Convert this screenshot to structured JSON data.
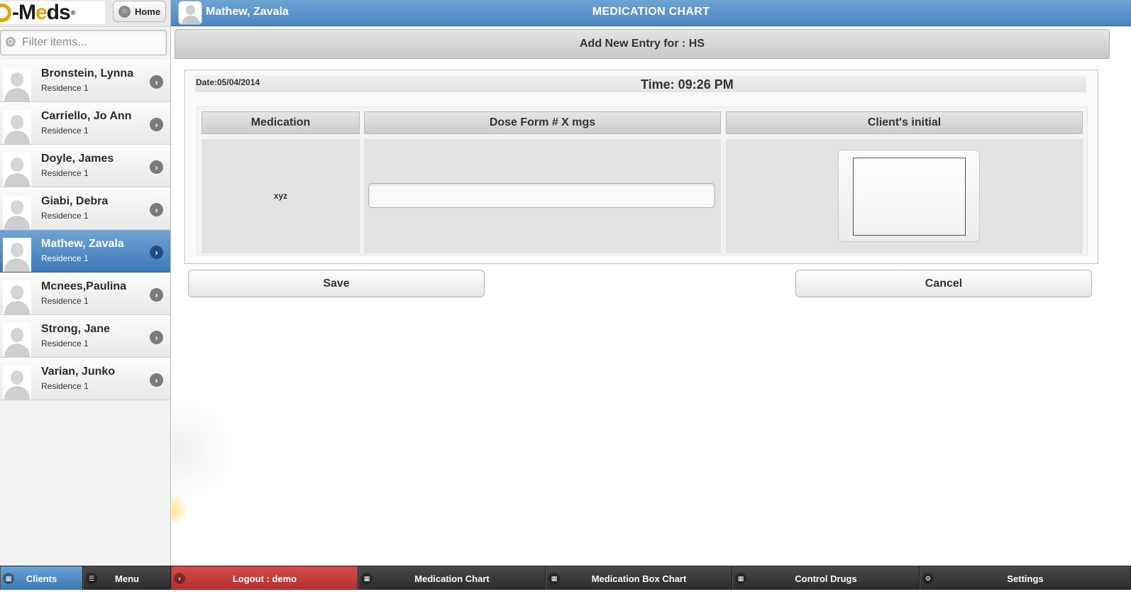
{
  "app": {
    "logo_text": "O-Meds",
    "home_label": "Home"
  },
  "sidebar": {
    "filter_placeholder": "Filter items...",
    "clients": [
      {
        "name": "Bronstein, Lynna",
        "residence": "Residence 1",
        "active": false
      },
      {
        "name": "Carriello, Jo Ann",
        "residence": "Residence 1",
        "active": false
      },
      {
        "name": "Doyle, James",
        "residence": "Residence 1",
        "active": false
      },
      {
        "name": "Giabi, Debra",
        "residence": "Residence 1",
        "active": false
      },
      {
        "name": "Mathew, Zavala",
        "residence": "Residence 1",
        "active": true
      },
      {
        "name": "Mcnees,Paulina",
        "residence": "Residence 1",
        "active": false
      },
      {
        "name": "Strong, Jane",
        "residence": "Residence 1",
        "active": false
      },
      {
        "name": "Varian, Junko",
        "residence": "Residence 1",
        "active": false
      }
    ]
  },
  "header": {
    "client_name": "Mathew, Zavala",
    "title": "MEDICATION CHART"
  },
  "form": {
    "heading": "Add New Entry for : HS",
    "date": "Date:05/04/2014",
    "time": "Time: 09:26 PM",
    "columns": {
      "medication": "Medication",
      "dose": "Dose Form # X mgs",
      "initial": "Client's initial"
    },
    "medication_value": "xyz",
    "dose_value": "",
    "save_label": "Save",
    "cancel_label": "Cancel"
  },
  "footer": {
    "clients": "Clients",
    "menu": "Menu",
    "logout": "Logout : demo",
    "medication_chart": "Medication Chart",
    "medication_box_chart": "Medication Box Chart",
    "control_drugs": "Control Drugs",
    "settings": "Settings"
  },
  "icons": {
    "home": "home-icon",
    "search": "search-icon",
    "chevron": "chevron-right-icon",
    "grid": "grid-icon",
    "menu": "menu-lines-icon",
    "back": "chevron-left-icon",
    "settings": "gear-icon"
  },
  "colors": {
    "accent_blue": "#4a86c2",
    "logout_red": "#c23b3b",
    "logo_orange": "#e6a400"
  }
}
